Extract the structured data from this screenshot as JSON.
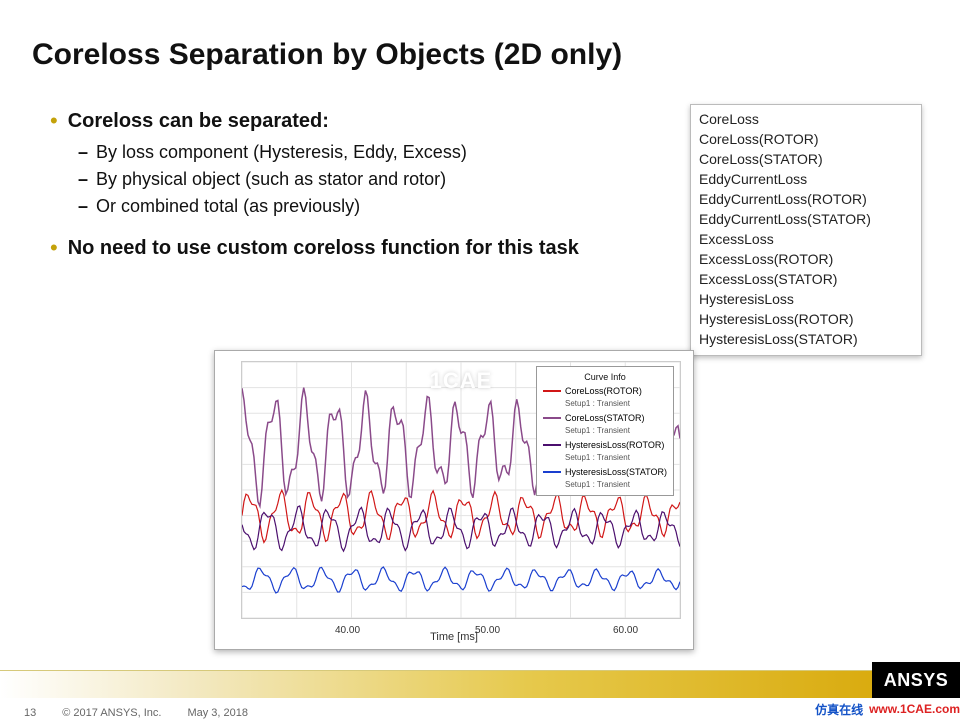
{
  "title": "Coreloss Separation by Objects (2D only)",
  "bullets": [
    {
      "text": "Coreloss can be separated:",
      "sub": [
        "By loss component (Hysteresis, Eddy, Excess)",
        "By physical object (such as stator and rotor)",
        "Or combined total (as previously)"
      ]
    },
    {
      "text": "No need to use custom coreloss function for this task",
      "sub": []
    }
  ],
  "list_items": [
    "CoreLoss",
    "CoreLoss(ROTOR)",
    "CoreLoss(STATOR)",
    "EddyCurrentLoss",
    "EddyCurrentLoss(ROTOR)",
    "EddyCurrentLoss(STATOR)",
    "ExcessLoss",
    "ExcessLoss(ROTOR)",
    "ExcessLoss(STATOR)",
    "HysteresisLoss",
    "HysteresisLoss(ROTOR)",
    "HysteresisLoss(STATOR)"
  ],
  "chart": {
    "watermark": "1CAE",
    "legend_title": "Curve Info",
    "legend_sub": "Setup1 : Transient",
    "xlabel": "Time [ms]",
    "ticks": [
      "40.00",
      "50.00",
      "60.00"
    ]
  },
  "chart_data": {
    "type": "line",
    "title": "",
    "xlabel": "Time [ms]",
    "ylabel": "",
    "ylim": [
      0,
      100
    ],
    "x": "30–65 ms (approx, oscillatory transient)",
    "series": [
      {
        "name": "CoreLoss(ROTOR)",
        "setup": "Setup1 : Transient",
        "color": "#d11717",
        "mean_pct": 40,
        "amp_pct": 8,
        "offset_note": "lower band, red"
      },
      {
        "name": "CoreLoss(STATOR)",
        "setup": "Setup1 : Transient",
        "color": "#8a4a8a",
        "mean_pct": 67,
        "amp_pct": 18,
        "offset_note": "top band, light purple"
      },
      {
        "name": "HysteresisLoss(ROTOR)",
        "setup": "Setup1 : Transient",
        "color": "#4b0f6e",
        "mean_pct": 35,
        "amp_pct": 7,
        "offset_note": "dark purple just under red"
      },
      {
        "name": "HysteresisLoss(STATOR)",
        "setup": "Setup1 : Transient",
        "color": "#1a3fcf",
        "mean_pct": 15,
        "amp_pct": 4,
        "offset_note": "bottom band, blue"
      }
    ]
  },
  "footer": {
    "page": "13",
    "copyright": "© 2017 ANSYS, Inc.",
    "date": "May 3, 2018"
  },
  "brand": {
    "ansys": "ANSYS",
    "cn": "仿真在线",
    "url": "www.1CAE.com"
  }
}
